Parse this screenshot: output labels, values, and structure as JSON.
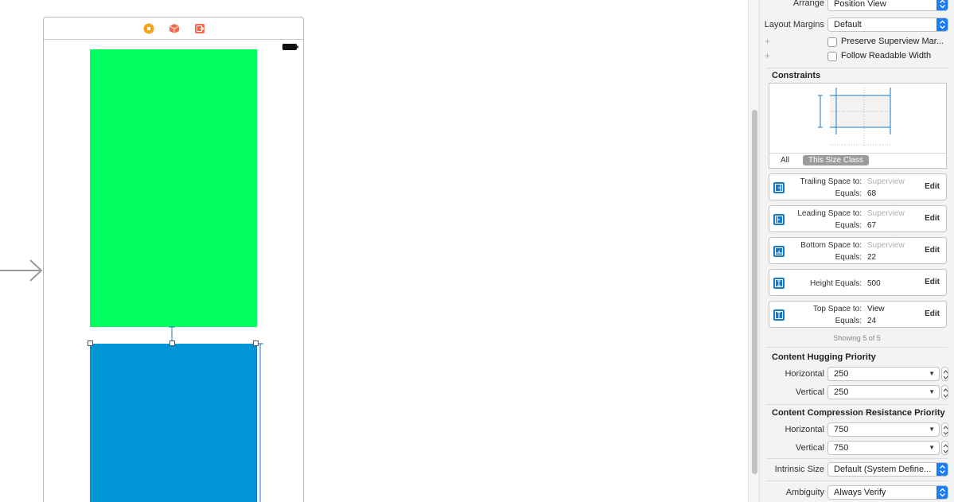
{
  "inspector": {
    "arrange": {
      "label": "Arrange",
      "value": "Position View"
    },
    "layout_margins": {
      "label": "Layout Margins",
      "value": "Default"
    },
    "preserve_superview": {
      "label": "Preserve Superview Mar...",
      "checked": false
    },
    "follow_readable": {
      "label": "Follow Readable Width",
      "checked": false
    },
    "constraints_title": "Constraints",
    "diagram_tabs": {
      "all": "All",
      "this_size_class": "This Size Class"
    },
    "constraints": [
      {
        "label1": "Trailing Space to:",
        "value1": "Superview",
        "label2": "Equals:",
        "value2": "68",
        "edit": "Edit",
        "icon": "trailing-space-icon"
      },
      {
        "label1": "Leading Space to:",
        "value1": "Superview",
        "label2": "Equals:",
        "value2": "67",
        "edit": "Edit",
        "icon": "leading-space-icon"
      },
      {
        "label1": "Bottom Space to:",
        "value1": "Superview",
        "label2": "Equals:",
        "value2": "22",
        "edit": "Edit",
        "icon": "bottom-space-icon"
      },
      {
        "label1": "Height Equals:",
        "value1": "500",
        "edit": "Edit",
        "icon": "height-icon"
      },
      {
        "label1": "Top Space to:",
        "value1": "View",
        "label2": "Equals:",
        "value2": "24",
        "edit": "Edit",
        "icon": "top-space-icon"
      }
    ],
    "showing": "Showing 5 of 5",
    "hugging": {
      "title": "Content Hugging Priority",
      "horizontal_label": "Horizontal",
      "horizontal_value": "250",
      "vertical_label": "Vertical",
      "vertical_value": "250"
    },
    "compression": {
      "title": "Content Compression Resistance Priority",
      "horizontal_label": "Horizontal",
      "horizontal_value": "750",
      "vertical_label": "Vertical",
      "vertical_value": "750"
    },
    "intrinsic_size": {
      "label": "Intrinsic Size",
      "value": "Default (System Define..."
    },
    "ambiguity": {
      "label": "Ambiguity",
      "value": "Always Verify"
    }
  },
  "colors": {
    "green_view": "#00ff5e",
    "blue_view": "#0095d4",
    "accent": "#1a7cf5",
    "constraint_line": "#1a79c6"
  },
  "scene_dock_icons": [
    "view-controller-icon",
    "first-responder-icon",
    "exit-icon"
  ]
}
